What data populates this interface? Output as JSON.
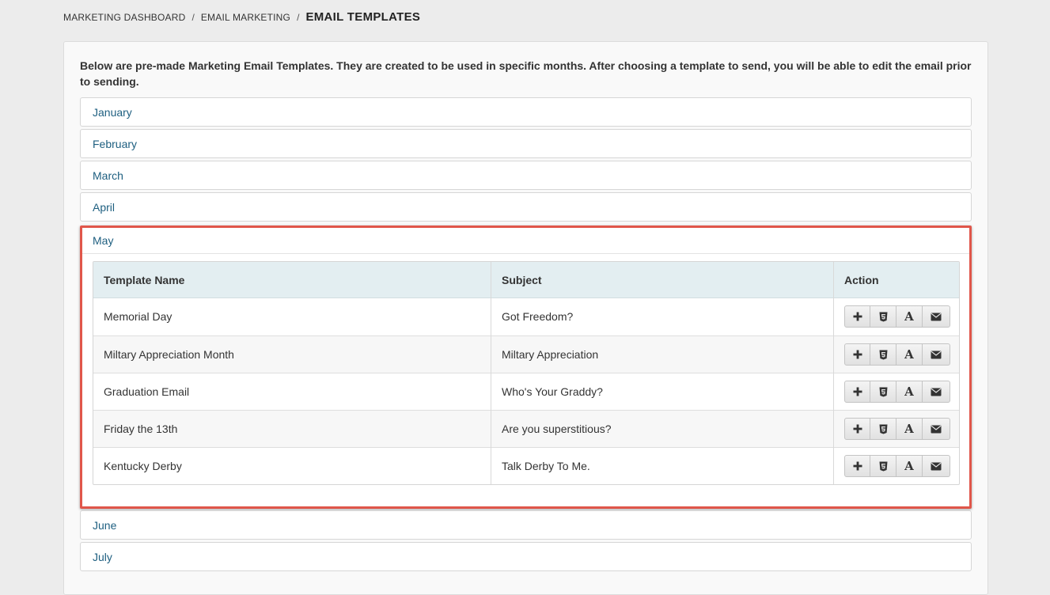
{
  "breadcrumb": {
    "items": [
      "MARKETING DASHBOARD",
      "EMAIL MARKETING"
    ],
    "separator": "/",
    "current": "EMAIL TEMPLATES"
  },
  "intro": "Below are pre-made Marketing Email Templates. They are created to be used in specific months. After choosing a template to send, you will be able to edit the email prior to sending.",
  "months": [
    "January",
    "February",
    "March",
    "April",
    "May",
    "June",
    "July"
  ],
  "open_month": "May",
  "table": {
    "headers": [
      "Template Name",
      "Subject",
      "Action"
    ],
    "rows": [
      {
        "name": "Memorial Day",
        "subject": "Got Freedom?"
      },
      {
        "name": "Miltary Appreciation Month",
        "subject": "Miltary Appreciation"
      },
      {
        "name": "Graduation Email",
        "subject": "Who's Your Graddy?"
      },
      {
        "name": "Friday the 13th",
        "subject": "Are you superstitious?"
      },
      {
        "name": "Kentucky Derby",
        "subject": "Talk Derby To Me."
      }
    ],
    "action_icons": [
      "plus-icon",
      "html5-icon",
      "font-icon",
      "envelope-icon"
    ]
  },
  "colors": {
    "link": "#1e5f80",
    "highlight_border": "#e0564a",
    "table_header_bg": "#e3eef1",
    "page_bg": "#ececec"
  }
}
